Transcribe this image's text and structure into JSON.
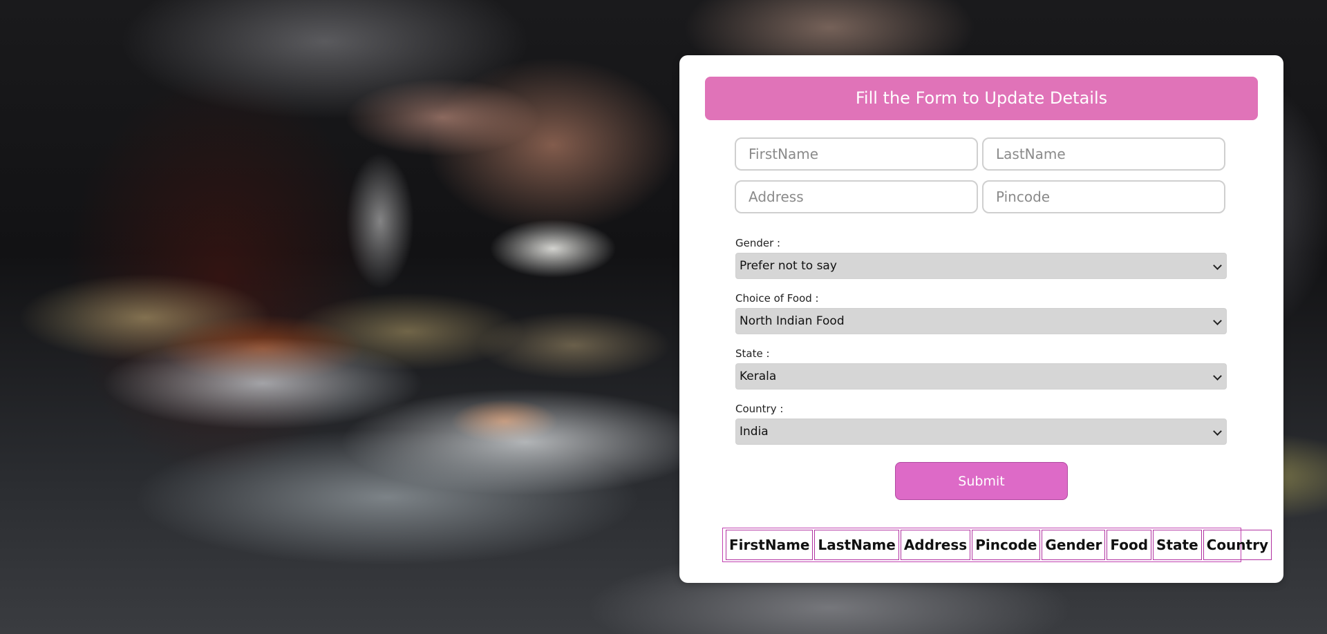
{
  "form": {
    "title": "Fill the Form to Update Details",
    "inputs": {
      "firstname_placeholder": "FirstName",
      "lastname_placeholder": "LastName",
      "address_placeholder": "Address",
      "pincode_placeholder": "Pincode"
    },
    "gender": {
      "label": "Gender :",
      "value": "Prefer not to say"
    },
    "food": {
      "label": "Choice of Food :",
      "value": "North Indian Food"
    },
    "state": {
      "label": "State :",
      "value": "Kerala"
    },
    "country": {
      "label": "Country :",
      "value": "India"
    },
    "submit_label": "Submit"
  },
  "table": {
    "headers": [
      "FirstName",
      "LastName",
      "Address",
      "Pincode",
      "Gender",
      "Food",
      "State",
      "Country"
    ]
  },
  "colors": {
    "header_bg": "#e073b8",
    "submit_bg": "#dd6ac7",
    "table_border": "#b030a0"
  }
}
